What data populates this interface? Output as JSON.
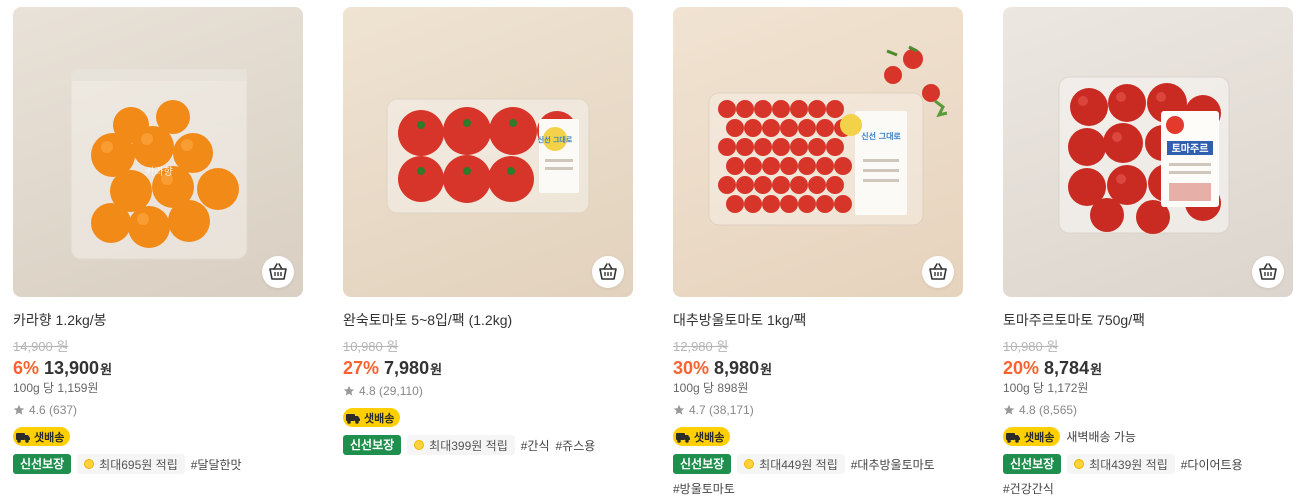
{
  "products": [
    {
      "name": "카라향 1.2kg/봉",
      "original_price": "14,900 원",
      "discount": "6%",
      "price": "13,900",
      "currency": "원",
      "unit_price": "100g 당 1,159원",
      "rating": "4.6",
      "reviews": "(637)",
      "delivery_badge": "샛배송",
      "delivery_note": "",
      "fresh_badge": "신선보장",
      "points": "최대695원 적립",
      "tags": [
        "#달달한맛"
      ],
      "extra_tags": []
    },
    {
      "name": "완숙토마토 5~8입/팩 (1.2kg)",
      "original_price": "10,980 원",
      "discount": "27%",
      "price": "7,980",
      "currency": "원",
      "unit_price": "",
      "rating": "4.8",
      "reviews": "(29,110)",
      "delivery_badge": "샛배송",
      "delivery_note": "",
      "fresh_badge": "신선보장",
      "points": "최대399원 적립",
      "tags": [
        "#간식",
        "#쥬스용"
      ],
      "extra_tags": []
    },
    {
      "name": "대추방울토마토 1kg/팩",
      "original_price": "12,980 원",
      "discount": "30%",
      "price": "8,980",
      "currency": "원",
      "unit_price": "100g 당 898원",
      "rating": "4.7",
      "reviews": "(38,171)",
      "delivery_badge": "샛배송",
      "delivery_note": "",
      "fresh_badge": "신선보장",
      "points": "최대449원 적립",
      "tags": [
        "#대추방울토마토"
      ],
      "extra_tags": [
        "#방울토마토"
      ]
    },
    {
      "name": "토마주르토마토 750g/팩",
      "original_price": "10,980 원",
      "discount": "20%",
      "price": "8,784",
      "currency": "원",
      "unit_price": "100g 당 1,172원",
      "rating": "4.8",
      "reviews": "(8,565)",
      "delivery_badge": "샛배송",
      "delivery_note": "새벽배송 가능",
      "fresh_badge": "신선보장",
      "points": "최대439원 적립",
      "tags": [
        "#다이어트용"
      ],
      "extra_tags": [
        "#건강간식"
      ]
    }
  ],
  "product_images": [
    {
      "icon": "mandarin-bag-image",
      "label_line": "카라향"
    },
    {
      "icon": "tomato-pack-image",
      "label_line": "신선 그대로"
    },
    {
      "icon": "cherry-tomato-pack-image",
      "label_line": "신선 그대로"
    },
    {
      "icon": "tomajur-pack-image",
      "label_line": "토마주르"
    }
  ],
  "icons": {
    "cart": "shopping-basket-icon",
    "star": "star-icon",
    "truck": "delivery-truck-icon",
    "coin": "point-coin-icon"
  },
  "colors": {
    "discount": "#fa622f",
    "fresh_badge": "#1f8f4d",
    "delivery_badge": "#ffcf00",
    "tomato": "#d8352a",
    "mandarin": "#f28a18"
  }
}
